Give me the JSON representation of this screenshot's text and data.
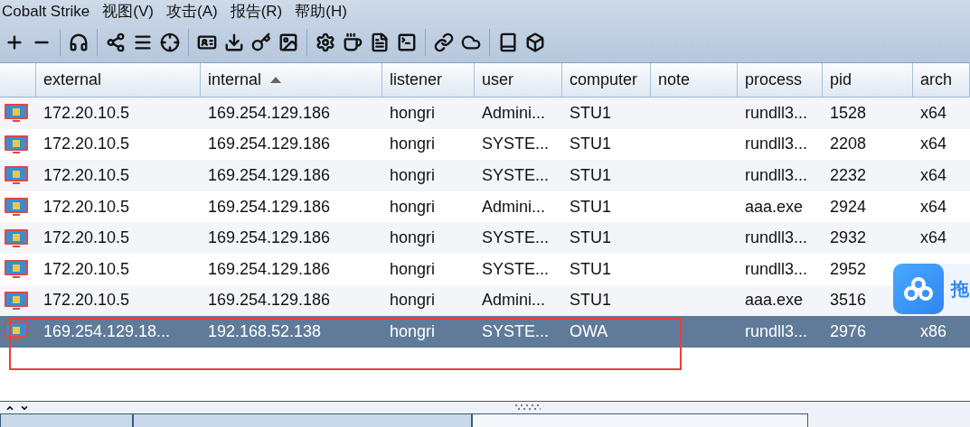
{
  "menu": [
    "Cobalt Strike",
    "视图(V)",
    "攻击(A)",
    "报告(R)",
    "帮助(H)"
  ],
  "toolbar": [
    {
      "kind": "plus"
    },
    {
      "kind": "minus"
    },
    {
      "kind": "sep"
    },
    {
      "kind": "headphones"
    },
    {
      "kind": "sep"
    },
    {
      "kind": "share"
    },
    {
      "kind": "list"
    },
    {
      "kind": "crosshair"
    },
    {
      "kind": "sep"
    },
    {
      "kind": "card"
    },
    {
      "kind": "download"
    },
    {
      "kind": "key"
    },
    {
      "kind": "image"
    },
    {
      "kind": "sep"
    },
    {
      "kind": "gear"
    },
    {
      "kind": "coffee"
    },
    {
      "kind": "file"
    },
    {
      "kind": "terminal"
    },
    {
      "kind": "sep"
    },
    {
      "kind": "link"
    },
    {
      "kind": "cloud"
    },
    {
      "kind": "sep"
    },
    {
      "kind": "book"
    },
    {
      "kind": "box"
    }
  ],
  "table": {
    "columns": [
      {
        "label": "external",
        "sorted": false
      },
      {
        "label": "internal",
        "sorted": true
      },
      {
        "label": "listener",
        "sorted": false
      },
      {
        "label": "user",
        "sorted": false
      },
      {
        "label": "computer",
        "sorted": false
      },
      {
        "label": "note",
        "sorted": false
      },
      {
        "label": "process",
        "sorted": false
      },
      {
        "label": "pid",
        "sorted": false
      },
      {
        "label": "arch",
        "sorted": false
      }
    ],
    "rows": [
      {
        "selected": false,
        "cells": [
          "172.20.10.5",
          "169.254.129.186",
          "hongri",
          "Admini...",
          "STU1",
          "",
          "rundll3...",
          "1528",
          "x64"
        ]
      },
      {
        "selected": false,
        "cells": [
          "172.20.10.5",
          "169.254.129.186",
          "hongri",
          "SYSTE...",
          "STU1",
          "",
          "rundll3...",
          "2208",
          "x64"
        ]
      },
      {
        "selected": false,
        "cells": [
          "172.20.10.5",
          "169.254.129.186",
          "hongri",
          "SYSTE...",
          "STU1",
          "",
          "rundll3...",
          "2232",
          "x64"
        ]
      },
      {
        "selected": false,
        "cells": [
          "172.20.10.5",
          "169.254.129.186",
          "hongri",
          "Admini...",
          "STU1",
          "",
          "aaa.exe",
          "2924",
          "x64"
        ]
      },
      {
        "selected": false,
        "cells": [
          "172.20.10.5",
          "169.254.129.186",
          "hongri",
          "SYSTE...",
          "STU1",
          "",
          "rundll3...",
          "2932",
          "x64"
        ]
      },
      {
        "selected": false,
        "cells": [
          "172.20.10.5",
          "169.254.129.186",
          "hongri",
          "SYSTE...",
          "STU1",
          "",
          "rundll3...",
          "2952",
          ""
        ]
      },
      {
        "selected": false,
        "cells": [
          "172.20.10.5",
          "169.254.129.186",
          "hongri",
          "Admini...",
          "STU1",
          "",
          "aaa.exe",
          "3516",
          ""
        ]
      },
      {
        "selected": true,
        "cells": [
          "169.254.129.18...",
          "192.168.52.138",
          "hongri",
          "SYSTE...",
          "OWA",
          "",
          "rundll3...",
          "2976",
          "x86"
        ]
      }
    ]
  },
  "floating_widget": {
    "label": "拖"
  },
  "bottom_tabs": [
    {
      "selected": false
    },
    {
      "selected": false
    },
    {
      "selected": true
    }
  ]
}
